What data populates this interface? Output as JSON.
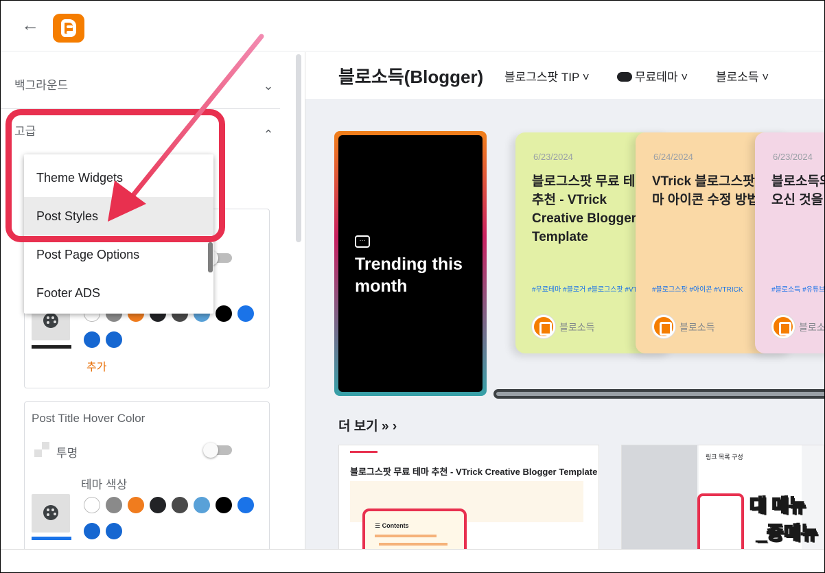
{
  "topbar": {
    "back_icon": "arrow-left-icon",
    "logo_icon": "blogger-logo-icon"
  },
  "left_panel": {
    "background_label": "백그라운드",
    "advanced_label": "고급",
    "card1": {
      "add_label": "추가"
    },
    "card2": {
      "title": "Post Title Hover Color",
      "transparent_label": "투명",
      "theme_colors_label": "테마 색상"
    },
    "swatch_colors": [
      "#ffffff",
      "#8a8a8a",
      "#f07c1e",
      "#222326",
      "#4a4a4a",
      "#59a1d8",
      "#000000",
      "#1a73e8",
      "#1667d1",
      "#1667d1"
    ]
  },
  "dropdown": {
    "items": [
      {
        "label": "Theme Widgets"
      },
      {
        "label": "Post Styles"
      },
      {
        "label": "Post Page Options"
      },
      {
        "label": "Footer ADS"
      }
    ],
    "selected": "Post Styles"
  },
  "preview": {
    "site_title": "블로소득(Blogger)",
    "nav": [
      {
        "label": "블로그스팟 TIP ˅"
      },
      {
        "label": "무료테마 ˅",
        "icon": "cloud-download-icon"
      },
      {
        "label": "블로소득 ˅"
      }
    ],
    "trending_label": "Trending this month",
    "trending_icon": "comment-icon",
    "posts": [
      {
        "date": "6/23/2024",
        "title": "블로그스팟 무료 테마 추천 - VTrick Creative Blogger Template",
        "tags": "#무료테마   #블로거   #블로그스팟   #VTRICK",
        "author": "블로소득",
        "bg": "#e3f0a6"
      },
      {
        "date": "6/24/2024",
        "title": "VTrick 블로그스팟 테마 아이콘 수정 방법",
        "tags": "#블로그스팟   #아이콘   #VTRICK",
        "author": "블로소득",
        "bg": "#fad9a6"
      },
      {
        "date": "6/23/2024",
        "title": "블로소득의 블로그에 오신 것을 환영합니다!",
        "tags": "#블로소득   #유튜브",
        "author": "블로소득",
        "bg": "#f3d6e6"
      }
    ],
    "more_heading": "더 보기 » ›",
    "thumb1_title": "블로그스팟 무료 테마 추천 - VTrick Creative Blogger Template",
    "thumb1_contents": "☰ Contents",
    "thumb2_header": "링크 목록 구성",
    "thumb2_big1": "대 메뉴",
    "thumb2_big2": "_중메뉴"
  }
}
